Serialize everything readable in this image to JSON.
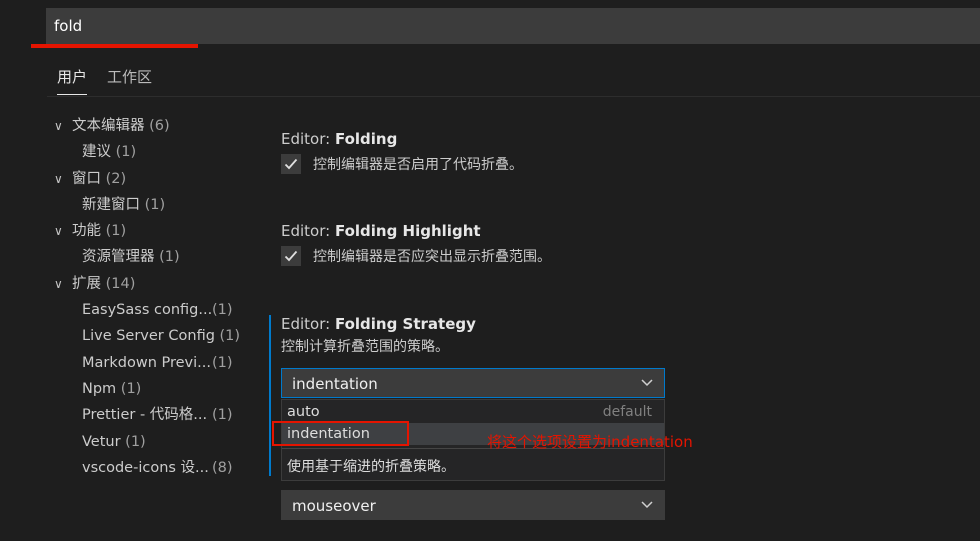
{
  "search": {
    "value": "fold"
  },
  "tabs": [
    {
      "label": "用户",
      "active": true
    },
    {
      "label": "工作区",
      "active": false
    }
  ],
  "toc": [
    {
      "label": "文本编辑器",
      "count": "(6)",
      "level": 0,
      "expanded": true
    },
    {
      "label": "建议",
      "count": "(1)",
      "level": 1
    },
    {
      "label": "窗口",
      "count": "(2)",
      "level": 0,
      "expanded": true
    },
    {
      "label": "新建窗口",
      "count": "(1)",
      "level": 1
    },
    {
      "label": "功能",
      "count": "(1)",
      "level": 0,
      "expanded": true
    },
    {
      "label": "资源管理器",
      "count": "(1)",
      "level": 1
    },
    {
      "label": "扩展",
      "count": "(14)",
      "level": 0,
      "expanded": true
    },
    {
      "label": "EasySass config...",
      "count": "(1)",
      "level": 1,
      "ext": true
    },
    {
      "label": "Live Server Config",
      "count": "(1)",
      "level": 1,
      "ext": true
    },
    {
      "label": "Markdown Previ...",
      "count": "(1)",
      "level": 1,
      "ext": true
    },
    {
      "label": "Npm",
      "count": "(1)",
      "level": 1
    },
    {
      "label": "Prettier - 代码格...",
      "count": "(1)",
      "level": 1,
      "ext": true
    },
    {
      "label": "Vetur",
      "count": "(1)",
      "level": 1
    },
    {
      "label": "vscode-icons 设...",
      "count": "(8)",
      "level": 1,
      "ext": true
    }
  ],
  "settings": {
    "folding": {
      "category": "Editor: ",
      "name": "Folding",
      "description": "控制编辑器是否启用了代码折叠。",
      "checked": true
    },
    "folding_highlight": {
      "category": "Editor: ",
      "name": "Folding Highlight",
      "description": "控制编辑器是否应突出显示折叠范围。",
      "checked": true
    },
    "folding_strategy": {
      "category": "Editor: ",
      "name": "Folding Strategy",
      "description": "控制计算折叠范围的策略。",
      "selected": "indentation",
      "options": [
        {
          "label": "auto",
          "hint": "default"
        },
        {
          "label": "indentation",
          "hint": ""
        }
      ],
      "option_description": "使用基于缩进的折叠策略。"
    },
    "next_select": {
      "selected": "mouseover"
    }
  },
  "annotation": {
    "text": "将这个选项设置为indentation",
    "color": "#e51400"
  },
  "colors": {
    "accent": "#007acc",
    "annotation": "#e51400",
    "background": "#1e1e1e"
  }
}
